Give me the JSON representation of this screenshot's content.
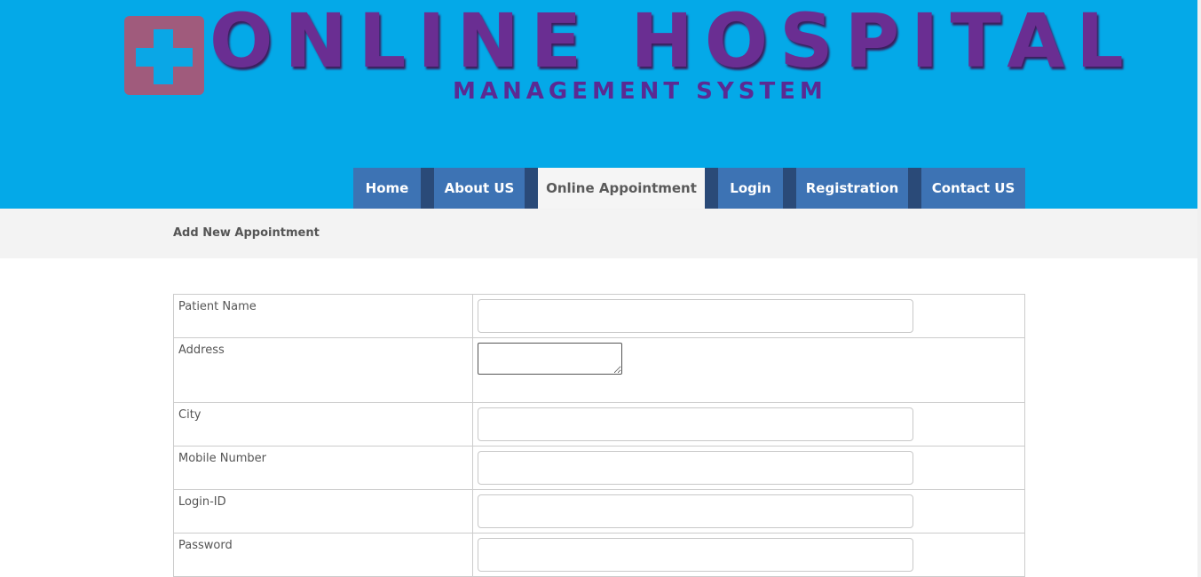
{
  "branding": {
    "title": "ONLINE HOSPITAL",
    "subtitle": "MANAGEMENT SYSTEM"
  },
  "nav": {
    "items": [
      {
        "label": "Home"
      },
      {
        "label": "About US"
      },
      {
        "label": "Online Appointment"
      },
      {
        "label": "Login"
      },
      {
        "label": "Registration"
      },
      {
        "label": "Contact US"
      }
    ],
    "active": "Online Appointment"
  },
  "page": {
    "heading": "Add New Appointment"
  },
  "form": {
    "fields": [
      {
        "label": "Patient Name",
        "value": ""
      },
      {
        "label": "Address",
        "value": ""
      },
      {
        "label": "City",
        "value": ""
      },
      {
        "label": "Mobile Number",
        "value": ""
      },
      {
        "label": "Login-ID",
        "value": ""
      },
      {
        "label": "Password",
        "value": ""
      }
    ]
  },
  "colors": {
    "header_bg": "#04a9e8",
    "nav_bg": "#3d73b4",
    "nav_separator": "#2a4a78",
    "nav_active_bg": "#f5f5f5",
    "logo_text": "#6a2e92",
    "logo_cross_bg": "#a05b7c"
  }
}
